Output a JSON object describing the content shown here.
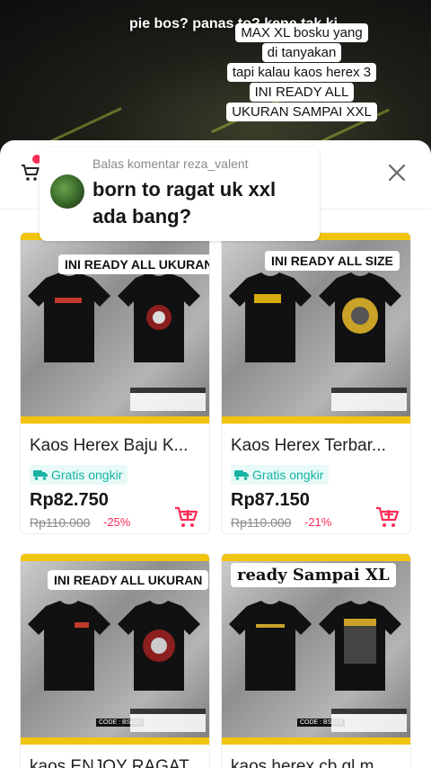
{
  "video": {
    "top_text": "pie bos? panas to? kene tak ki",
    "caption": [
      "MAX XL bosku yang",
      "di tanyakan",
      "tapi kalau kaos herex 3",
      "INI READY ALL",
      "UKURAN SAMPAI XXL"
    ]
  },
  "reply": {
    "title": "Balas komentar reza_valent",
    "body": "born to ragat uk xxl ada bang?"
  },
  "products": [
    {
      "overlay": "INI READY ALL UKURAN",
      "title": "Kaos Herex Baju K...",
      "shipping": "Gratis ongkir",
      "price": "Rp82.750",
      "original_price": "Rp110.000",
      "discount": "-25%"
    },
    {
      "overlay": "INI READY ALL SIZE",
      "title": "Kaos Herex Terbar...",
      "shipping": "Gratis ongkir",
      "price": "Rp87.150",
      "original_price": "Rp110.000",
      "discount": "-21%"
    },
    {
      "overlay": "INI READY ALL UKURAN",
      "title": "kaos ENJOY RAGAT...",
      "code": "CODE : BS020"
    },
    {
      "overlay": "ready Sampai XL",
      "title": "kaos herex cb gl m...",
      "code": "CODE : BS019"
    }
  ],
  "colors": {
    "accent_red": "#fe2c55",
    "shipping_teal": "#16b3a2",
    "banner_yellow": "#f1c40f"
  },
  "icons": [
    "cart-icon",
    "close-icon",
    "truck-icon",
    "add-to-cart-icon"
  ]
}
